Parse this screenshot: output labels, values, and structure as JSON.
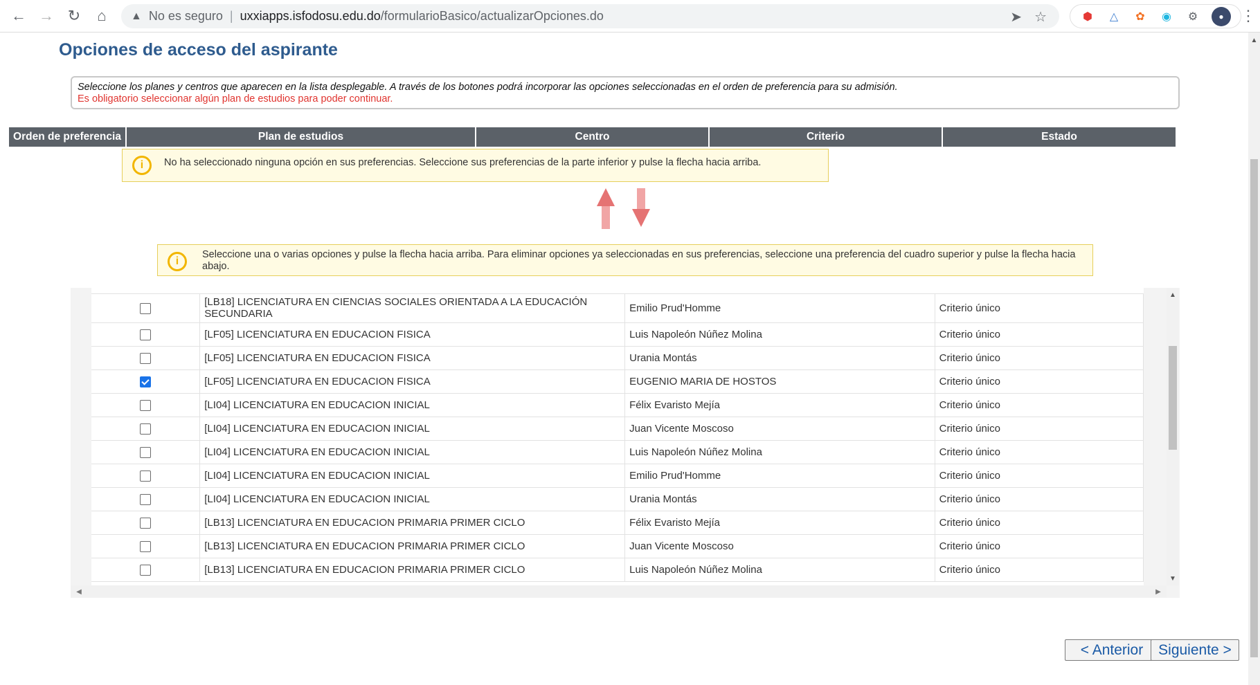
{
  "browser": {
    "security_label": "No es seguro",
    "url_host": "uxxiapps.isfodosu.edu.do",
    "url_path": "/formularioBasico/actualizarOpciones.do"
  },
  "page": {
    "title": "Opciones de acceso del aspirante",
    "info_text": "Seleccione los planes y centros que aparecen en la lista desplegable. A través de los botones podrá incorporar las opciones seleccionadas en el orden de preferencia para su admisión.",
    "required_text": "Es obligatorio seleccionar algún plan de estudios para poder continuar."
  },
  "preferences": {
    "headers": [
      "Orden de preferencia",
      "Plan de estudios",
      "Centro",
      "Criterio",
      "Estado"
    ],
    "empty_notice": "No ha seleccionado ninguna opción en sus preferencias. Seleccione sus preferencias de la parte inferior y pulse la flecha hacia arriba."
  },
  "options": {
    "notice": "Seleccione una o varias opciones y pulse la flecha hacia arriba. Para eliminar opciones ya seleccionadas en sus preferencias, seleccione una preferencia del cuadro superior y pulse la flecha hacia abajo.",
    "rows": [
      {
        "checked": false,
        "plan": "[LB18] LICENCIATURA EN CIENCIAS SOCIALES ORIENTADA A LA EDUCACIÓN SECUNDARIA",
        "centro": "Emilio Prud'Homme",
        "criterio": "Criterio único"
      },
      {
        "checked": false,
        "plan": "[LF05] LICENCIATURA EN EDUCACION FISICA",
        "centro": "Luis Napoleón Núñez Molina",
        "criterio": "Criterio único"
      },
      {
        "checked": false,
        "plan": "[LF05] LICENCIATURA EN EDUCACION FISICA",
        "centro": "Urania Montás",
        "criterio": "Criterio único"
      },
      {
        "checked": true,
        "plan": "[LF05] LICENCIATURA EN EDUCACION FISICA",
        "centro": "EUGENIO MARIA DE HOSTOS",
        "criterio": "Criterio único"
      },
      {
        "checked": false,
        "plan": "[LI04] LICENCIATURA EN EDUCACION INICIAL",
        "centro": "Félix Evaristo Mejía",
        "criterio": "Criterio único"
      },
      {
        "checked": false,
        "plan": "[LI04] LICENCIATURA EN EDUCACION INICIAL",
        "centro": "Juan Vicente Moscoso",
        "criterio": "Criterio único"
      },
      {
        "checked": false,
        "plan": "[LI04] LICENCIATURA EN EDUCACION INICIAL",
        "centro": "Luis Napoleón Núñez Molina",
        "criterio": "Criterio único"
      },
      {
        "checked": false,
        "plan": "[LI04] LICENCIATURA EN EDUCACION INICIAL",
        "centro": "Emilio Prud'Homme",
        "criterio": "Criterio único"
      },
      {
        "checked": false,
        "plan": "[LI04] LICENCIATURA EN EDUCACION INICIAL",
        "centro": "Urania Montás",
        "criterio": "Criterio único"
      },
      {
        "checked": false,
        "plan": "[LB13] LICENCIATURA EN EDUCACION PRIMARIA PRIMER CICLO",
        "centro": "Félix Evaristo Mejía",
        "criterio": "Criterio único"
      },
      {
        "checked": false,
        "plan": "[LB13] LICENCIATURA EN EDUCACION PRIMARIA PRIMER CICLO",
        "centro": "Juan Vicente Moscoso",
        "criterio": "Criterio único"
      },
      {
        "checked": false,
        "plan": "[LB13] LICENCIATURA EN EDUCACION PRIMARIA PRIMER CICLO",
        "centro": "Luis Napoleón Núñez Molina",
        "criterio": "Criterio único"
      }
    ]
  },
  "buttons": {
    "prev": "< Anterior",
    "next": "Siguiente >"
  },
  "colors": {
    "title": "#2e5b8e",
    "header_bg": "#5b6168",
    "required": "#e0342f",
    "notice_bg": "#fffbe3",
    "arrow": "#e57373"
  },
  "icons": [
    "back-icon",
    "forward-icon",
    "reload-icon",
    "home-icon",
    "warning-icon",
    "send-icon",
    "star-icon",
    "extensions-icon",
    "arrow-up-icon",
    "arrow-down-icon"
  ]
}
